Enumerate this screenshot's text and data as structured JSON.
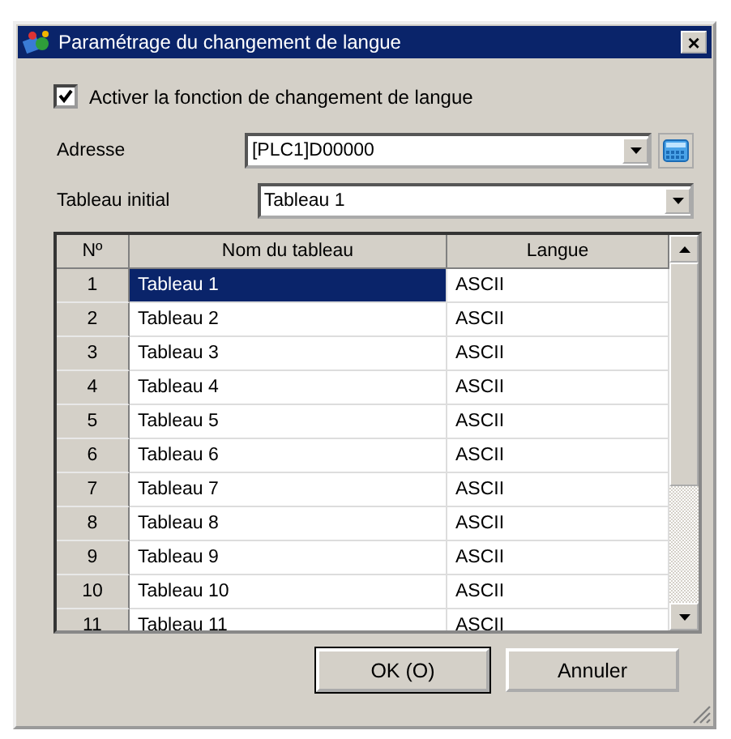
{
  "window": {
    "title": "Paramétrage du changement de langue",
    "close": "×"
  },
  "enable": {
    "label": "Activer la fonction de changement de langue",
    "checked": true
  },
  "address": {
    "label": "Adresse",
    "value": "[PLC1]D00000"
  },
  "initial_table": {
    "label": "Tableau initial",
    "value": "Tableau 1"
  },
  "table": {
    "columns": [
      "Nº",
      "Nom du tableau",
      "Langue"
    ],
    "rows": [
      {
        "no": "1",
        "name": "Tableau 1",
        "lang": "ASCII",
        "selected": true
      },
      {
        "no": "2",
        "name": "Tableau 2",
        "lang": "ASCII",
        "selected": false
      },
      {
        "no": "3",
        "name": "Tableau 3",
        "lang": "ASCII",
        "selected": false
      },
      {
        "no": "4",
        "name": "Tableau 4",
        "lang": "ASCII",
        "selected": false
      },
      {
        "no": "5",
        "name": "Tableau 5",
        "lang": "ASCII",
        "selected": false
      },
      {
        "no": "6",
        "name": "Tableau 6",
        "lang": "ASCII",
        "selected": false
      },
      {
        "no": "7",
        "name": "Tableau 7",
        "lang": "ASCII",
        "selected": false
      },
      {
        "no": "8",
        "name": "Tableau 8",
        "lang": "ASCII",
        "selected": false
      },
      {
        "no": "9",
        "name": "Tableau 9",
        "lang": "ASCII",
        "selected": false
      },
      {
        "no": "10",
        "name": "Tableau 10",
        "lang": "ASCII",
        "selected": false
      },
      {
        "no": "11",
        "name": "Tableau 11",
        "lang": "ASCII",
        "selected": false
      }
    ]
  },
  "buttons": [
    "OK (O)",
    "Annuler"
  ]
}
